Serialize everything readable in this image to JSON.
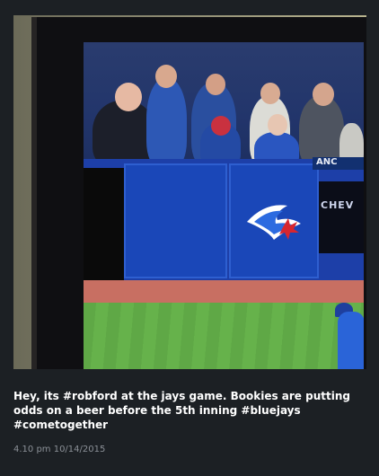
{
  "post": {
    "caption": "Hey, its #robford at the jays game. Bookies are putting odds on a beer before the 5th inning #bluejays #cometogether",
    "timestamp": "4.10 pm 10/14/2015"
  },
  "photo": {
    "scoreboard_label": "CHEV",
    "banner_label": "ANC",
    "colors": {
      "field_blue": "#1a47b8",
      "grass": "#5fa846",
      "dirt": "#c86f62"
    }
  }
}
